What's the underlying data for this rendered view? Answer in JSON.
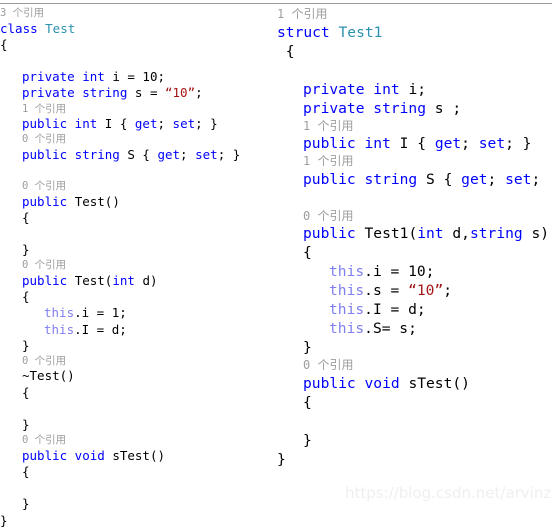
{
  "watermark": {
    "text": "https://blog.csdn.net/arvinzd"
  },
  "colors": {
    "background": "#ffffff",
    "keyword": "#0000ff",
    "user_type": "#2b91af",
    "string_literal": "#a31515",
    "this_keyword": "#8080f0",
    "plain_text": "#000000",
    "codelens_hint": "#9d9d9d",
    "divider": "#9a9a9a",
    "watermark": "#efefef"
  },
  "left_pane": {
    "name": "class-test-code",
    "language": "csharp",
    "lines": [
      {
        "type": "lens",
        "indent": 0,
        "tokens": [
          {
            "t": "3 个引用",
            "c": "lens"
          }
        ]
      },
      {
        "type": "code",
        "indent": 0,
        "tokens": [
          {
            "t": "class ",
            "c": "kw"
          },
          {
            "t": "Test",
            "c": "type"
          }
        ]
      },
      {
        "type": "code",
        "indent": 0,
        "tokens": [
          {
            "t": "{",
            "c": "pl"
          }
        ]
      },
      {
        "type": "blank",
        "indent": 0,
        "tokens": []
      },
      {
        "type": "code",
        "indent": 1,
        "tokens": [
          {
            "t": "private int ",
            "c": "kw"
          },
          {
            "t": "i = 10;",
            "c": "pl"
          }
        ]
      },
      {
        "type": "code",
        "indent": 1,
        "tokens": [
          {
            "t": "private string ",
            "c": "kw"
          },
          {
            "t": "s = ",
            "c": "pl"
          },
          {
            "t": "“10”",
            "c": "str"
          },
          {
            "t": ";",
            "c": "pl"
          }
        ]
      },
      {
        "type": "lens",
        "indent": 1,
        "tokens": [
          {
            "t": "1 个引用",
            "c": "lens"
          }
        ]
      },
      {
        "type": "code",
        "indent": 1,
        "tokens": [
          {
            "t": "public int ",
            "c": "kw"
          },
          {
            "t": "I { ",
            "c": "pl"
          },
          {
            "t": "get",
            "c": "kw"
          },
          {
            "t": "; ",
            "c": "pl"
          },
          {
            "t": "set",
            "c": "kw"
          },
          {
            "t": "; }",
            "c": "pl"
          }
        ]
      },
      {
        "type": "lens",
        "indent": 1,
        "tokens": [
          {
            "t": "0 个引用",
            "c": "lens"
          }
        ]
      },
      {
        "type": "code",
        "indent": 1,
        "tokens": [
          {
            "t": "public string ",
            "c": "kw"
          },
          {
            "t": "S { ",
            "c": "pl"
          },
          {
            "t": "get",
            "c": "kw"
          },
          {
            "t": "; ",
            "c": "pl"
          },
          {
            "t": "set",
            "c": "kw"
          },
          {
            "t": "; }",
            "c": "pl"
          }
        ]
      },
      {
        "type": "blank",
        "indent": 0,
        "tokens": []
      },
      {
        "type": "lens",
        "indent": 1,
        "tokens": [
          {
            "t": "0 个引用",
            "c": "lens"
          }
        ]
      },
      {
        "type": "code",
        "indent": 1,
        "tokens": [
          {
            "t": "public ",
            "c": "kw"
          },
          {
            "t": "Test()",
            "c": "pl"
          }
        ]
      },
      {
        "type": "code",
        "indent": 1,
        "tokens": [
          {
            "t": "{",
            "c": "pl"
          }
        ]
      },
      {
        "type": "blank",
        "indent": 0,
        "tokens": []
      },
      {
        "type": "code",
        "indent": 1,
        "tokens": [
          {
            "t": "}",
            "c": "pl"
          }
        ]
      },
      {
        "type": "lens",
        "indent": 1,
        "tokens": [
          {
            "t": "0 个引用",
            "c": "lens"
          }
        ]
      },
      {
        "type": "code",
        "indent": 1,
        "tokens": [
          {
            "t": "public ",
            "c": "kw"
          },
          {
            "t": "Test(",
            "c": "pl"
          },
          {
            "t": "int ",
            "c": "kw"
          },
          {
            "t": "d)",
            "c": "pl"
          }
        ]
      },
      {
        "type": "code",
        "indent": 1,
        "tokens": [
          {
            "t": "{",
            "c": "pl"
          }
        ]
      },
      {
        "type": "code",
        "indent": 2,
        "tokens": [
          {
            "t": "this",
            "c": "this"
          },
          {
            "t": ".i = 1;",
            "c": "pl"
          }
        ]
      },
      {
        "type": "code",
        "indent": 2,
        "tokens": [
          {
            "t": "this",
            "c": "this"
          },
          {
            "t": ".I = d;",
            "c": "pl"
          }
        ]
      },
      {
        "type": "code",
        "indent": 1,
        "tokens": [
          {
            "t": "}",
            "c": "pl"
          }
        ]
      },
      {
        "type": "lens",
        "indent": 1,
        "tokens": [
          {
            "t": "0 个引用",
            "c": "lens"
          }
        ]
      },
      {
        "type": "code",
        "indent": 1,
        "tokens": [
          {
            "t": "~Test()",
            "c": "pl"
          }
        ]
      },
      {
        "type": "code",
        "indent": 1,
        "tokens": [
          {
            "t": "{",
            "c": "pl"
          }
        ]
      },
      {
        "type": "blank",
        "indent": 0,
        "tokens": []
      },
      {
        "type": "code",
        "indent": 1,
        "tokens": [
          {
            "t": "}",
            "c": "pl"
          }
        ]
      },
      {
        "type": "lens",
        "indent": 1,
        "tokens": [
          {
            "t": "0 个引用",
            "c": "lens"
          }
        ]
      },
      {
        "type": "code",
        "indent": 1,
        "tokens": [
          {
            "t": "public void ",
            "c": "kw"
          },
          {
            "t": "sTest()",
            "c": "pl"
          }
        ]
      },
      {
        "type": "code",
        "indent": 1,
        "tokens": [
          {
            "t": "{",
            "c": "pl"
          }
        ]
      },
      {
        "type": "blank",
        "indent": 0,
        "tokens": []
      },
      {
        "type": "code",
        "indent": 1,
        "tokens": [
          {
            "t": "}",
            "c": "pl"
          }
        ]
      },
      {
        "type": "code",
        "indent": 0,
        "tokens": [
          {
            "t": "}",
            "c": "pl"
          }
        ]
      }
    ]
  },
  "right_pane": {
    "name": "struct-test1-code",
    "language": "csharp",
    "lines": [
      {
        "type": "lens",
        "indent": 0,
        "tokens": [
          {
            "t": "1 个引用",
            "c": "lens"
          }
        ]
      },
      {
        "type": "code",
        "indent": 0,
        "tokens": [
          {
            "t": "struct ",
            "c": "kw"
          },
          {
            "t": "Test1",
            "c": "type"
          }
        ]
      },
      {
        "type": "code",
        "indent": 0,
        "tokens": [
          {
            "t": " {",
            "c": "pl"
          }
        ]
      },
      {
        "type": "blank",
        "indent": 0,
        "tokens": []
      },
      {
        "type": "code",
        "indent": 1,
        "tokens": [
          {
            "t": "private int ",
            "c": "kw"
          },
          {
            "t": "i;",
            "c": "pl"
          }
        ]
      },
      {
        "type": "code",
        "indent": 1,
        "tokens": [
          {
            "t": "private string ",
            "c": "kw"
          },
          {
            "t": "s ;",
            "c": "pl"
          }
        ]
      },
      {
        "type": "lens",
        "indent": 1,
        "tokens": [
          {
            "t": "1 个引用",
            "c": "lens"
          }
        ]
      },
      {
        "type": "code",
        "indent": 1,
        "tokens": [
          {
            "t": "public int ",
            "c": "kw"
          },
          {
            "t": "I { ",
            "c": "pl"
          },
          {
            "t": "get",
            "c": "kw"
          },
          {
            "t": "; ",
            "c": "pl"
          },
          {
            "t": "set",
            "c": "kw"
          },
          {
            "t": "; }",
            "c": "pl"
          }
        ]
      },
      {
        "type": "lens",
        "indent": 1,
        "tokens": [
          {
            "t": "1 个引用",
            "c": "lens"
          }
        ]
      },
      {
        "type": "code",
        "indent": 1,
        "tokens": [
          {
            "t": "public string ",
            "c": "kw"
          },
          {
            "t": "S { ",
            "c": "pl"
          },
          {
            "t": "get",
            "c": "kw"
          },
          {
            "t": "; ",
            "c": "pl"
          },
          {
            "t": "set",
            "c": "kw"
          },
          {
            "t": ";",
            "c": "pl"
          }
        ]
      },
      {
        "type": "blank",
        "indent": 0,
        "tokens": []
      },
      {
        "type": "lens",
        "indent": 1,
        "tokens": [
          {
            "t": "0 个引用",
            "c": "lens"
          }
        ]
      },
      {
        "type": "code",
        "indent": 1,
        "tokens": [
          {
            "t": "public ",
            "c": "kw"
          },
          {
            "t": "Test1(",
            "c": "pl"
          },
          {
            "t": "int ",
            "c": "kw"
          },
          {
            "t": "d,",
            "c": "pl"
          },
          {
            "t": "string ",
            "c": "kw"
          },
          {
            "t": "s)",
            "c": "pl"
          }
        ]
      },
      {
        "type": "code",
        "indent": 1,
        "tokens": [
          {
            "t": "{",
            "c": "pl"
          }
        ]
      },
      {
        "type": "code",
        "indent": 2,
        "tokens": [
          {
            "t": "this",
            "c": "this"
          },
          {
            "t": ".i = 10;",
            "c": "pl"
          }
        ]
      },
      {
        "type": "code",
        "indent": 2,
        "tokens": [
          {
            "t": "this",
            "c": "this"
          },
          {
            "t": ".s = ",
            "c": "pl"
          },
          {
            "t": "“10”",
            "c": "str"
          },
          {
            "t": ";",
            "c": "pl"
          }
        ]
      },
      {
        "type": "code",
        "indent": 2,
        "tokens": [
          {
            "t": "this",
            "c": "this"
          },
          {
            "t": ".I = d;",
            "c": "pl"
          }
        ]
      },
      {
        "type": "code",
        "indent": 2,
        "tokens": [
          {
            "t": "this",
            "c": "this"
          },
          {
            "t": ".S= s;",
            "c": "pl"
          }
        ]
      },
      {
        "type": "code",
        "indent": 1,
        "tokens": [
          {
            "t": "}",
            "c": "pl"
          }
        ]
      },
      {
        "type": "lens",
        "indent": 1,
        "tokens": [
          {
            "t": "0 个引用",
            "c": "lens"
          }
        ]
      },
      {
        "type": "code",
        "indent": 1,
        "tokens": [
          {
            "t": "public void ",
            "c": "kw"
          },
          {
            "t": "sTest()",
            "c": "pl"
          }
        ]
      },
      {
        "type": "code",
        "indent": 1,
        "tokens": [
          {
            "t": "{",
            "c": "pl"
          }
        ]
      },
      {
        "type": "blank",
        "indent": 0,
        "tokens": []
      },
      {
        "type": "code",
        "indent": 1,
        "tokens": [
          {
            "t": "}",
            "c": "pl"
          }
        ]
      },
      {
        "type": "code",
        "indent": 0,
        "tokens": [
          {
            "t": "}",
            "c": "pl"
          }
        ]
      }
    ]
  }
}
